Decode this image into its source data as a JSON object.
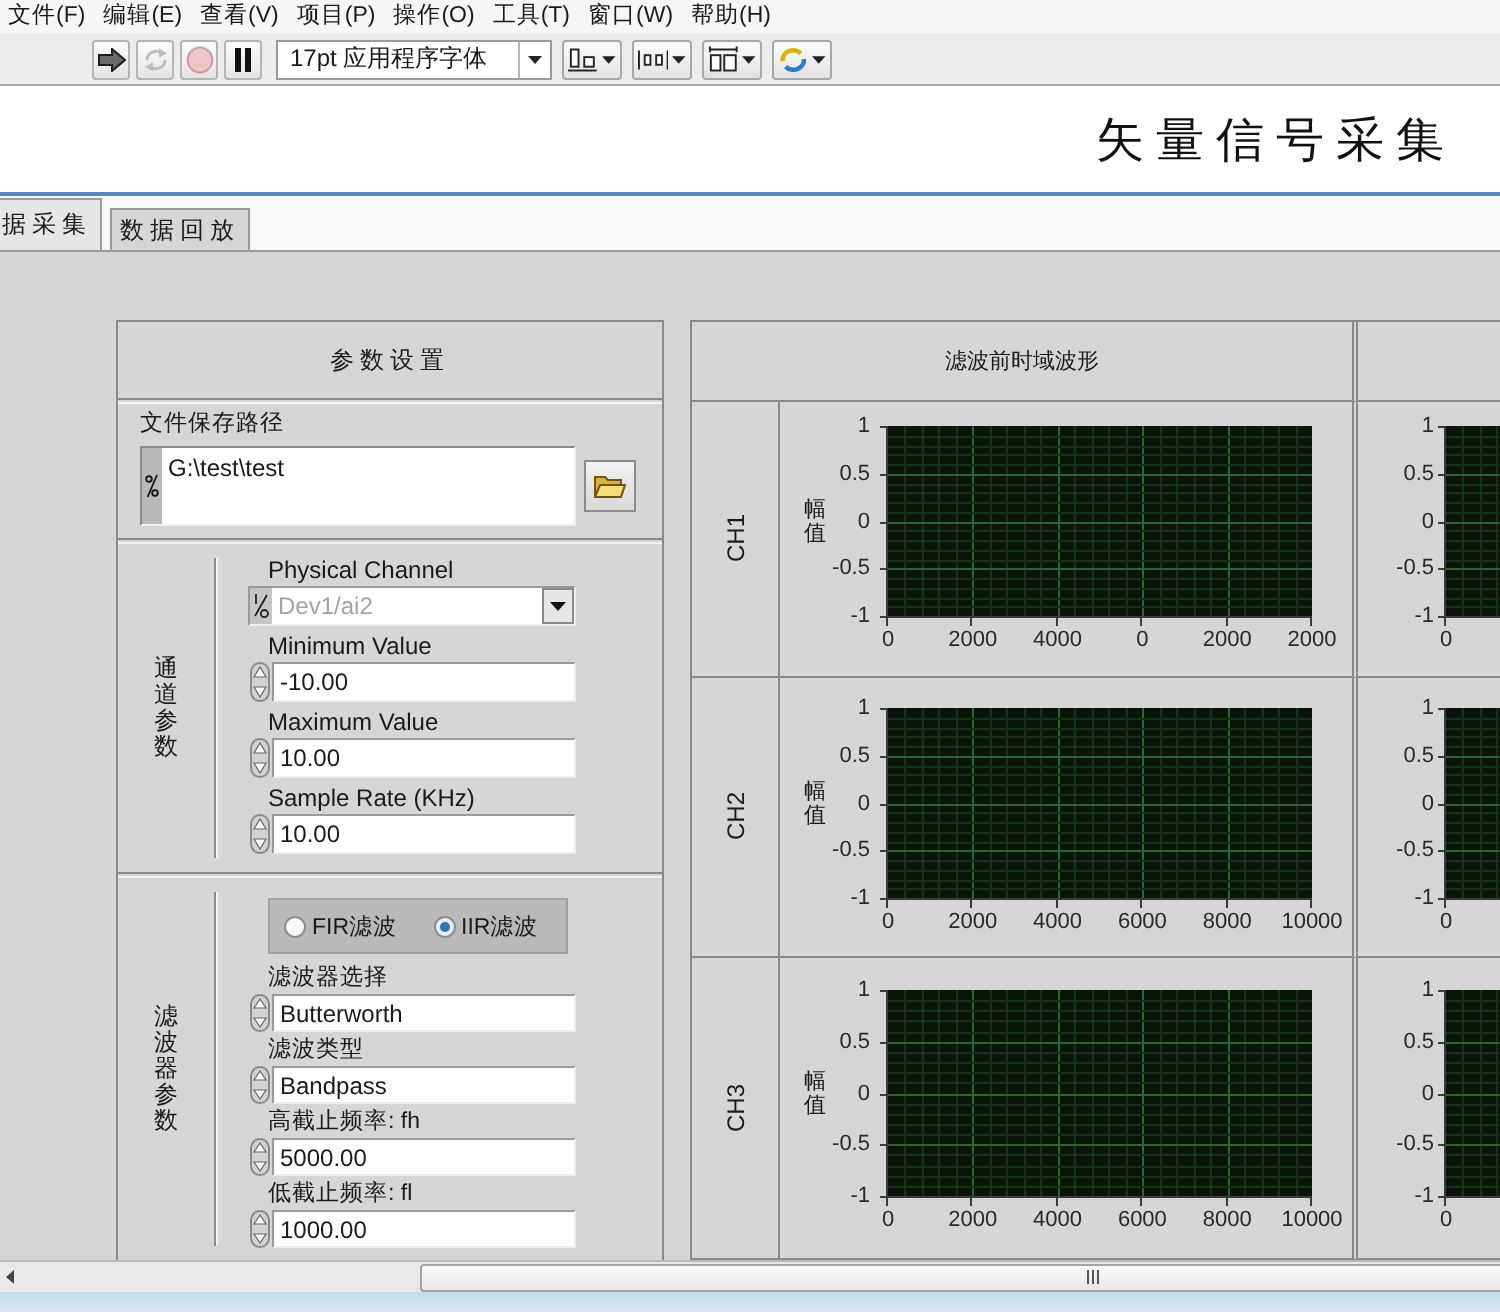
{
  "menu_bar": {
    "items": [
      "文件(F)",
      "编辑(E)",
      "查看(V)",
      "项目(P)",
      "操作(O)",
      "工具(T)",
      "窗口(W)",
      "帮助(H)"
    ]
  },
  "toolbar": {
    "buttons": [
      {
        "kind": "run",
        "disabled": false
      },
      {
        "kind": "run_continuously",
        "disabled": true
      },
      {
        "kind": "abort",
        "disabled": true
      },
      {
        "kind": "pause",
        "disabled": false
      }
    ],
    "font_menu": "17pt 应用程序字体",
    "tools": [
      {
        "kind": "align"
      },
      {
        "kind": "distribute"
      },
      {
        "kind": "resize"
      },
      {
        "kind": "reorder"
      }
    ]
  },
  "panel_title": "矢量信号采集",
  "tabs": [
    {
      "label": "据采集",
      "selected": true
    },
    {
      "label": "数据回放",
      "selected": false
    }
  ],
  "parameters": {
    "title": "参数设置",
    "file_path": {
      "label": "文件保存路径",
      "value": "G:\\test\\test"
    },
    "channel_section": {
      "title": "通道参数",
      "physical_channel": {
        "label": "Physical Channel",
        "value": "Dev1/ai2",
        "disabled": true
      },
      "fields": [
        {
          "label": "Minimum Value",
          "value": "-10.00"
        },
        {
          "label": "Maximum Value",
          "value": "10.00"
        },
        {
          "label": "Sample Rate (KHz)",
          "value": "10.00"
        }
      ]
    },
    "filter_section": {
      "title": "滤波器参数",
      "filter_type": [
        {
          "label": "FIR滤波",
          "selected": false
        },
        {
          "label": "IIR滤波",
          "selected": true
        }
      ],
      "fields": [
        {
          "label": "滤波器选择",
          "value": "Butterworth"
        },
        {
          "label": "滤波类型",
          "value": "Bandpass"
        },
        {
          "label": "高截止频率: fh",
          "value": "5000.00"
        },
        {
          "label": "低截止频率: fl",
          "value": "1000.00"
        }
      ]
    }
  },
  "waveforms": {
    "column_title": "滤波前时域波形",
    "rows": [
      {
        "channel": "CH1",
        "chart_picture": {
          "ylabel": "幅值",
          "y_tick_labels": [
            "1",
            "0.5",
            "0",
            "-0.5",
            "-1"
          ],
          "x_tick_labels": [
            "0",
            "2000",
            "4000",
            "0",
            "2000",
            "2000"
          ]
        },
        "column_2": {
          "y_tick_labels": [
            "1",
            "0.5",
            "0",
            "-0.5",
            "-1"
          ],
          "x_tick_labels": [
            "0"
          ]
        }
      },
      {
        "channel": "CH2",
        "chart_data": {
          "type": "line",
          "ylabel": "幅值",
          "grid": true,
          "xlim": [
            0,
            10000
          ],
          "ylim": [
            -1,
            1
          ],
          "xticks": [
            0,
            2000,
            4000,
            6000,
            8000,
            10000
          ],
          "yticks": [
            1,
            0.5,
            0,
            -0.5,
            -1
          ]
        },
        "column_2": {
          "y_tick_labels": [
            "1",
            "0.5",
            "0",
            "-0.5",
            "-1"
          ],
          "x_tick_labels": [
            "0"
          ]
        }
      },
      {
        "channel": "CH3",
        "chart_data": {
          "type": "line",
          "ylabel": "幅值",
          "grid": true,
          "xlim": [
            0,
            10000
          ],
          "ylim": [
            -1,
            1
          ],
          "xticks": [
            0,
            2000,
            4000,
            6000,
            8000,
            10000
          ],
          "yticks": [
            1,
            0.5,
            0,
            -0.5,
            -1
          ]
        },
        "column_2": {
          "y_tick_labels": [
            "1",
            "0.5",
            "0",
            "-0.5",
            "-1"
          ],
          "x_tick_labels": [
            "0"
          ]
        }
      }
    ]
  }
}
